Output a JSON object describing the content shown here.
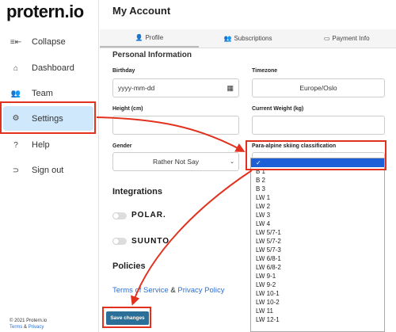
{
  "app": {
    "logo": "protern.io"
  },
  "sidebar": {
    "items": [
      {
        "label": "Collapse",
        "icon": "collapse-icon",
        "glyph": "≡⇤"
      },
      {
        "label": "Dashboard",
        "icon": "home-icon",
        "glyph": "⌂"
      },
      {
        "label": "Team",
        "icon": "team-icon",
        "glyph": "👥"
      },
      {
        "label": "Settings",
        "icon": "gear-icon",
        "glyph": "⚙"
      },
      {
        "label": "Help",
        "icon": "help-icon",
        "glyph": "?"
      },
      {
        "label": "Sign out",
        "icon": "sign-out-icon",
        "glyph": "⊃"
      }
    ],
    "footer_copyright": "© 2021 Protern.io",
    "footer_terms": "Terms",
    "footer_amp": "&",
    "footer_privacy": "Privacy"
  },
  "header": {
    "title": "My Account"
  },
  "tabs": [
    {
      "label": "Profile",
      "glyph": "👤"
    },
    {
      "label": "Subscriptions",
      "glyph": "👥"
    },
    {
      "label": "Payment Info",
      "glyph": "▭"
    }
  ],
  "personal": {
    "heading": "Personal Information"
  },
  "form": {
    "birthday_label": "Birthday",
    "birthday_value": "yyyy-mm-dd",
    "timezone_label": "Timezone",
    "timezone_value": "Europe/Oslo",
    "height_label": "Height (cm)",
    "height_value": "",
    "weight_label": "Current Weight (kg)",
    "weight_value": "",
    "gender_label": "Gender",
    "gender_value": "Rather Not Say",
    "classification_label": "Para-alpine skiing classification"
  },
  "dropdown": {
    "options": [
      "✓",
      "B 1",
      "B 2",
      "B 3",
      "LW 1",
      "LW 2",
      "LW 3",
      "LW 4",
      "LW 5/7-1",
      "LW 5/7-2",
      "LW 5/7-3",
      "LW 6/8-1",
      "LW 6/8-2",
      "LW 9-1",
      "LW 9-2",
      "LW 10-1",
      "LW 10-2",
      "LW 11",
      "LW 12-1"
    ],
    "selected_index": 0
  },
  "integrations": {
    "heading": "Integrations",
    "items": [
      {
        "brand": "POLAR."
      },
      {
        "brand": "SUUNTO"
      }
    ]
  },
  "policies": {
    "heading": "Policies",
    "terms": "Terms of Service",
    "amp": "&",
    "privacy": "Privacy Policy"
  },
  "save_button": "Save changes",
  "colors": {
    "accent": "#2b6f99",
    "highlight": "#e2321f",
    "active_nav": "#cfe8fb",
    "link": "#2a6fd6",
    "selected_option": "#1d5fd6"
  }
}
